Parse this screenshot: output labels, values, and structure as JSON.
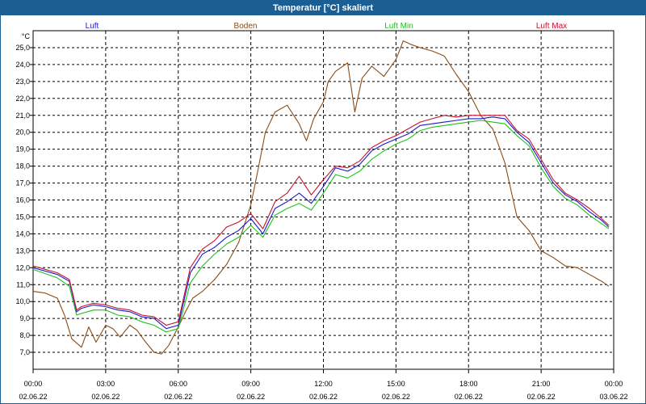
{
  "window": {
    "title": "Temperatur [°C] skaliert"
  },
  "chart_data": {
    "type": "line",
    "title": "Temperatur [°C] skaliert",
    "ylabel": "°C",
    "ylim": [
      6,
      26
    ],
    "xlim": [
      0,
      24
    ],
    "grid": true,
    "y_ticks": [
      "7,0",
      "8,0",
      "9,0",
      "10,0",
      "11,0",
      "12,0",
      "13,0",
      "14,0",
      "15,0",
      "16,0",
      "17,0",
      "18,0",
      "19,0",
      "20,0",
      "21,0",
      "22,0",
      "23,0",
      "24,0",
      "25,0"
    ],
    "x_ticks": [
      {
        "time": "00:00",
        "date": "02.06.22"
      },
      {
        "time": "03:00",
        "date": "02.06.22"
      },
      {
        "time": "06:00",
        "date": "02.06.22"
      },
      {
        "time": "09:00",
        "date": "02.06.22"
      },
      {
        "time": "12:00",
        "date": "02.06.22"
      },
      {
        "time": "15:00",
        "date": "02.06.22"
      },
      {
        "time": "18:00",
        "date": "02.06.22"
      },
      {
        "time": "21:00",
        "date": "02.06.22"
      },
      {
        "time": "00:00",
        "date": "03.06.22"
      }
    ],
    "series": [
      {
        "name": "Luft",
        "color": "#1a1ad0",
        "x": [
          0,
          1,
          1.5,
          1.8,
          2,
          2.5,
          3,
          3.5,
          4,
          4.5,
          5,
          5.5,
          6,
          6.5,
          7,
          7.5,
          8,
          8.5,
          9,
          9.5,
          10,
          10.5,
          11,
          11.5,
          12,
          12.5,
          13,
          13.5,
          14,
          14.5,
          15,
          15.5,
          16,
          16.5,
          17,
          17.5,
          18,
          18.5,
          19,
          19.5,
          20,
          20.5,
          21,
          21.5,
          22,
          22.5,
          23,
          23.5,
          23.8
        ],
        "y": [
          12.0,
          11.6,
          11.2,
          9.4,
          9.6,
          9.8,
          9.7,
          9.5,
          9.4,
          9.1,
          9.0,
          8.4,
          8.6,
          11.7,
          12.8,
          13.2,
          13.8,
          14.2,
          14.9,
          14.0,
          15.5,
          15.9,
          16.4,
          15.8,
          16.8,
          17.9,
          17.7,
          18.1,
          18.9,
          19.3,
          19.6,
          19.9,
          20.4,
          20.5,
          20.6,
          20.7,
          20.8,
          20.8,
          20.9,
          20.8,
          20.0,
          19.4,
          18.2,
          17.0,
          16.3,
          15.9,
          15.3,
          14.8,
          14.4
        ]
      },
      {
        "name": "Boden",
        "color": "#8b4a14",
        "x": [
          0,
          0.5,
          1,
          1.3,
          1.6,
          2,
          2.3,
          2.6,
          3,
          3.3,
          3.6,
          4,
          4.3,
          4.6,
          5,
          5.3,
          5.6,
          6,
          6.3,
          6.6,
          7,
          7.5,
          8,
          8.5,
          9,
          9.3,
          9.6,
          10,
          10.5,
          11,
          11.3,
          11.6,
          12,
          12.2,
          12.5,
          13,
          13.3,
          13.6,
          14,
          14.5,
          15,
          15.3,
          15.6,
          16,
          16.5,
          17,
          17.5,
          18,
          18.5,
          19,
          19.5,
          20,
          20.5,
          21,
          21.5,
          22,
          22.5,
          23,
          23.5,
          23.8
        ],
        "y": [
          10.6,
          10.5,
          10.2,
          9.2,
          7.8,
          7.3,
          8.5,
          7.6,
          8.6,
          8.4,
          7.9,
          8.6,
          8.3,
          7.7,
          7.0,
          6.9,
          7.4,
          8.5,
          9.4,
          10.2,
          10.6,
          11.3,
          12.2,
          13.5,
          15.7,
          17.8,
          20.0,
          21.2,
          21.6,
          20.5,
          19.5,
          20.8,
          21.8,
          23.0,
          23.6,
          24.1,
          21.2,
          23.2,
          23.9,
          23.3,
          24.3,
          25.4,
          25.2,
          25.0,
          24.8,
          24.5,
          23.4,
          22.4,
          21.0,
          20.2,
          18.2,
          15.0,
          14.2,
          13.0,
          12.6,
          12.1,
          12.0,
          11.6,
          11.2,
          10.9
        ]
      },
      {
        "name": "Luft Min",
        "color": "#1fbf1f",
        "x": [
          0,
          1,
          1.5,
          1.8,
          2,
          2.5,
          3,
          3.5,
          4,
          4.5,
          5,
          5.5,
          6,
          6.5,
          7,
          7.5,
          8,
          8.5,
          9,
          9.5,
          10,
          10.5,
          11,
          11.5,
          12,
          12.5,
          13,
          13.5,
          14,
          14.5,
          15,
          15.5,
          16,
          16.5,
          17,
          17.5,
          18,
          18.5,
          19,
          19.5,
          20,
          20.5,
          21,
          21.5,
          22,
          22.5,
          23,
          23.5,
          23.8
        ],
        "y": [
          11.9,
          11.4,
          10.9,
          9.2,
          9.3,
          9.5,
          9.5,
          9.2,
          9.1,
          8.8,
          8.6,
          8.2,
          8.4,
          11.1,
          12.1,
          12.8,
          13.4,
          13.8,
          14.5,
          13.8,
          15.1,
          15.5,
          15.8,
          15.4,
          16.4,
          17.5,
          17.3,
          17.7,
          18.4,
          18.9,
          19.3,
          19.6,
          20.1,
          20.3,
          20.4,
          20.5,
          20.6,
          20.7,
          20.6,
          20.5,
          19.8,
          19.2,
          17.9,
          16.8,
          16.1,
          15.7,
          15.1,
          14.6,
          14.3
        ]
      },
      {
        "name": "Luft Max",
        "color": "#c8102e",
        "x": [
          0,
          1,
          1.5,
          1.8,
          2,
          2.5,
          3,
          3.5,
          4,
          4.5,
          5,
          5.5,
          6,
          6.5,
          7,
          7.5,
          8,
          8.5,
          9,
          9.5,
          10,
          10.5,
          11,
          11.5,
          12,
          12.5,
          13,
          13.5,
          14,
          14.5,
          15,
          15.5,
          16,
          16.5,
          17,
          17.5,
          18,
          18.5,
          19,
          19.5,
          20,
          20.5,
          21,
          21.5,
          22,
          22.5,
          23,
          23.5,
          23.8
        ],
        "y": [
          12.1,
          11.7,
          11.3,
          9.5,
          9.7,
          9.9,
          9.8,
          9.6,
          9.5,
          9.2,
          9.1,
          8.6,
          8.8,
          12.0,
          13.1,
          13.6,
          14.4,
          14.7,
          15.2,
          14.3,
          15.9,
          16.4,
          17.4,
          16.3,
          17.2,
          18.0,
          17.9,
          18.3,
          19.1,
          19.5,
          19.8,
          20.2,
          20.6,
          20.8,
          21.0,
          20.9,
          21.0,
          21.0,
          21.0,
          21.0,
          20.1,
          19.6,
          18.4,
          17.2,
          16.4,
          16.0,
          15.5,
          14.9,
          14.5
        ]
      }
    ]
  }
}
